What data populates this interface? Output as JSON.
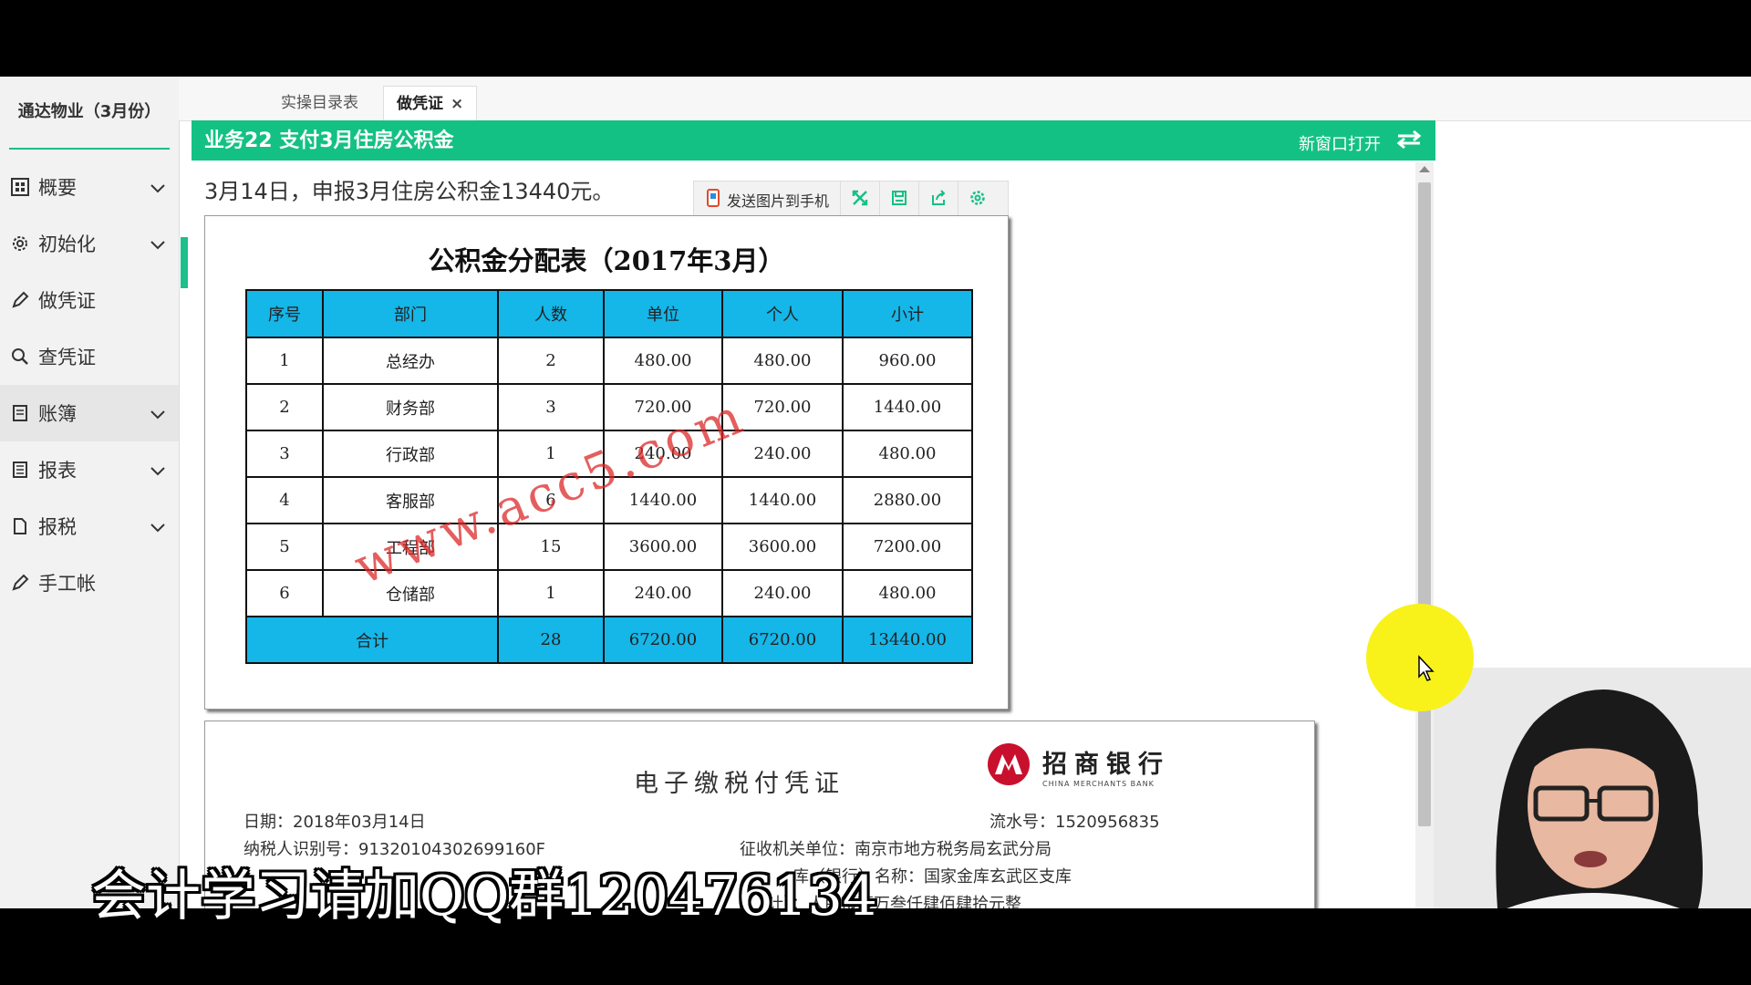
{
  "sidebar": {
    "company": "通达物业（3月份）",
    "items": [
      {
        "label": "概要",
        "icon": "grid-icon",
        "has_chevron": true
      },
      {
        "label": "初始化",
        "icon": "gear-icon",
        "has_chevron": true
      },
      {
        "label": "做凭证",
        "icon": "pen-icon",
        "has_chevron": false
      },
      {
        "label": "查凭证",
        "icon": "search-icon",
        "has_chevron": false
      },
      {
        "label": "账簿",
        "icon": "book-icon",
        "has_chevron": true
      },
      {
        "label": "报表",
        "icon": "report-icon",
        "has_chevron": true
      },
      {
        "label": "报税",
        "icon": "file-icon",
        "has_chevron": true
      },
      {
        "label": "手工帐",
        "icon": "pen-icon",
        "has_chevron": false
      }
    ]
  },
  "tabs": [
    {
      "label": "实操目录表"
    },
    {
      "label": "做凭证",
      "close": "×"
    }
  ],
  "header": {
    "title": "业务22 支付3月住房公积金",
    "open_new_window": "新窗口打开"
  },
  "description": "3月14日，申报3月住房公积金13440元。",
  "toolbar": {
    "send_label": "发送图片到手机"
  },
  "distribution_table": {
    "title": "公积金分配表（2017年3月）",
    "headers": [
      "序号",
      "部门",
      "人数",
      "单位",
      "个人",
      "小计"
    ],
    "rows": [
      [
        "1",
        "总经办",
        "2",
        "480.00",
        "480.00",
        "960.00"
      ],
      [
        "2",
        "财务部",
        "3",
        "720.00",
        "720.00",
        "1440.00"
      ],
      [
        "3",
        "行政部",
        "1",
        "240.00",
        "240.00",
        "480.00"
      ],
      [
        "4",
        "客服部",
        "6",
        "1440.00",
        "1440.00",
        "2880.00"
      ],
      [
        "5",
        "工程部",
        "15",
        "3600.00",
        "3600.00",
        "7200.00"
      ],
      [
        "6",
        "仓储部",
        "1",
        "240.00",
        "240.00",
        "480.00"
      ]
    ],
    "total": [
      "合计",
      "28",
      "6720.00",
      "6720.00",
      "13440.00"
    ],
    "watermark": "www.acc5.com"
  },
  "receipt": {
    "title": "电子缴税付凭证",
    "bank_name": "招商银行",
    "bank_english": "CHINA MERCHANTS BANK",
    "date": "日期：2018年03月14日",
    "serial": "流水号：1520956835",
    "taxpayer_id": "纳税人识别号：91320104302699160F",
    "collector": "征收机关单位：南京市地方税务局玄武分局",
    "treasury": "库（银行）名称：国家金库玄武区支库",
    "amount_words": "计）：人民币壹万叁仟肆佰肆拾元整"
  },
  "caption": "会计学习请加QQ群120476134",
  "colors": {
    "accent": "#14c184",
    "table_header": "#15b6e8",
    "highlight": "#f8f21a"
  }
}
